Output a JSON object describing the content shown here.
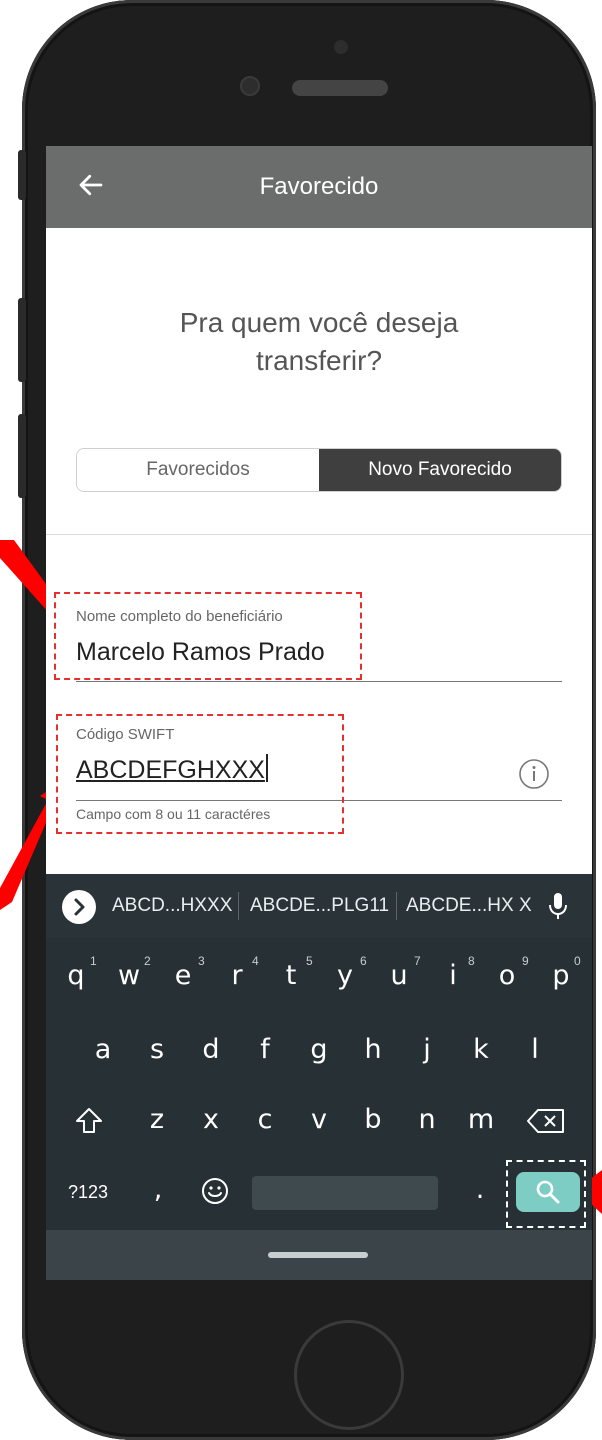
{
  "header": {
    "title": "Favorecido",
    "back_icon": "arrow-left-icon"
  },
  "question": "Pra quem você deseja transferir?",
  "segment": {
    "left": "Favorecidos",
    "right": "Novo Favorecido",
    "active": "right"
  },
  "form": {
    "name": {
      "label": "Nome completo do beneficiário",
      "value": "Marcelo Ramos Prado"
    },
    "swift": {
      "label": "Código SWIFT",
      "value": "ABCDEFGHXXX",
      "helper": "Campo com 8 ou 11 caractéres",
      "info_icon": "info-icon"
    }
  },
  "keyboard": {
    "suggestions": [
      "ABCD...HXXX",
      "ABCDE...PLG11",
      "ABCDE...HX X"
    ],
    "row1": [
      "q",
      "w",
      "e",
      "r",
      "t",
      "y",
      "u",
      "i",
      "o",
      "p"
    ],
    "row1_nums": [
      "1",
      "2",
      "3",
      "4",
      "5",
      "6",
      "7",
      "8",
      "9",
      "0"
    ],
    "row2": [
      "a",
      "s",
      "d",
      "f",
      "g",
      "h",
      "j",
      "k",
      "l"
    ],
    "row3": [
      "z",
      "x",
      "c",
      "v",
      "b",
      "n",
      "m"
    ],
    "symbols_label": "?123",
    "comma": ",",
    "period": ".",
    "icons": [
      "chevron-right-icon",
      "microphone-icon",
      "shift-icon",
      "backspace-icon",
      "emoji-icon",
      "search-icon"
    ]
  },
  "colors": {
    "appbar": "#6b6d6c",
    "segment_active": "#3f3f3f",
    "keyboard": "#263035",
    "search_key": "#7ecdc4",
    "highlight_red": "#e53030"
  }
}
